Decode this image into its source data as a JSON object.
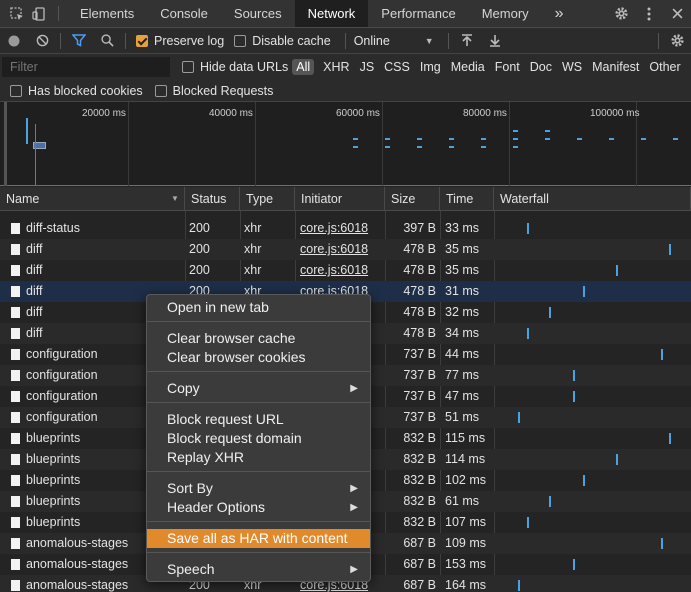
{
  "tabs": [
    "Elements",
    "Console",
    "Sources",
    "Network",
    "Performance",
    "Memory"
  ],
  "active_tab": "Network",
  "more_tabs": "»",
  "toolbar": {
    "preserve_log": "Preserve log",
    "disable_cache": "Disable cache",
    "throttle": "Online"
  },
  "filter": {
    "placeholder": "Filter",
    "hide_data_urls": "Hide data URLs",
    "types": [
      "All",
      "XHR",
      "JS",
      "CSS",
      "Img",
      "Media",
      "Font",
      "Doc",
      "WS",
      "Manifest",
      "Other"
    ],
    "has_blocked_cookies": "Has blocked cookies",
    "blocked_requests": "Blocked Requests"
  },
  "overview_labels": [
    "20000 ms",
    "40000 ms",
    "60000 ms",
    "80000 ms",
    "100000 ms"
  ],
  "columns": [
    "Name",
    "Status",
    "Type",
    "Initiator",
    "Size",
    "Time",
    "Waterfall"
  ],
  "rows": [
    {
      "name": "diff-status",
      "status": "200",
      "type": "xhr",
      "initiator": "core.js:6018",
      "size": "397 B",
      "time": "33 ms",
      "wf": 0.17
    },
    {
      "name": "diff",
      "status": "200",
      "type": "xhr",
      "initiator": "core.js:6018",
      "size": "478 B",
      "time": "35 ms",
      "wf": 0.89
    },
    {
      "name": "diff",
      "status": "200",
      "type": "xhr",
      "initiator": "core.js:6018",
      "size": "478 B",
      "time": "35 ms",
      "wf": 0.62
    },
    {
      "name": "diff",
      "status": "200",
      "type": "xhr",
      "initiator": "core.js:6018",
      "size": "478 B",
      "time": "31 ms",
      "wf": 0.45
    },
    {
      "name": "diff",
      "status": "",
      "type": "",
      "initiator": "",
      "size": "478 B",
      "time": "32 ms",
      "wf": 0.28
    },
    {
      "name": "diff",
      "status": "",
      "type": "",
      "initiator": "",
      "size": "478 B",
      "time": "34 ms",
      "wf": 0.17
    },
    {
      "name": "configuration",
      "status": "",
      "type": "",
      "initiator": "",
      "size": "737 B",
      "time": "44 ms",
      "wf": 0.85
    },
    {
      "name": "configuration",
      "status": "",
      "type": "",
      "initiator": "",
      "size": "737 B",
      "time": "77 ms",
      "wf": 0.4
    },
    {
      "name": "configuration",
      "status": "",
      "type": "",
      "initiator": "",
      "size": "737 B",
      "time": "47 ms",
      "wf": 0.4
    },
    {
      "name": "configuration",
      "status": "",
      "type": "",
      "initiator": "",
      "size": "737 B",
      "time": "51 ms",
      "wf": 0.12
    },
    {
      "name": "blueprints",
      "status": "",
      "type": "",
      "initiator": "",
      "size": "832 B",
      "time": "115 ms",
      "wf": 0.89
    },
    {
      "name": "blueprints",
      "status": "",
      "type": "",
      "initiator": "",
      "size": "832 B",
      "time": "114 ms",
      "wf": 0.62
    },
    {
      "name": "blueprints",
      "status": "",
      "type": "",
      "initiator": "",
      "size": "832 B",
      "time": "102 ms",
      "wf": 0.45
    },
    {
      "name": "blueprints",
      "status": "",
      "type": "",
      "initiator": "",
      "size": "832 B",
      "time": "61 ms",
      "wf": 0.28
    },
    {
      "name": "blueprints",
      "status": "",
      "type": "",
      "initiator": "",
      "size": "832 B",
      "time": "107 ms",
      "wf": 0.17
    },
    {
      "name": "anomalous-stages",
      "status": "",
      "type": "",
      "initiator": "",
      "size": "687 B",
      "time": "109 ms",
      "wf": 0.85
    },
    {
      "name": "anomalous-stages",
      "status": "",
      "type": "",
      "initiator": "",
      "size": "687 B",
      "time": "153 ms",
      "wf": 0.4
    },
    {
      "name": "anomalous-stages",
      "status": "200",
      "type": "xhr",
      "initiator": "core.js:6018",
      "size": "687 B",
      "time": "164 ms",
      "wf": 0.12
    }
  ],
  "context_menu": {
    "open_new_tab": "Open in new tab",
    "clear_cache": "Clear browser cache",
    "clear_cookies": "Clear browser cookies",
    "copy": "Copy",
    "block_url": "Block request URL",
    "block_domain": "Block request domain",
    "replay_xhr": "Replay XHR",
    "sort_by": "Sort By",
    "header_options": "Header Options",
    "save_har": "Save all as HAR with content",
    "speech": "Speech"
  },
  "colors": {
    "accent": "#e08a2c",
    "waterfall": "#4aa3e0",
    "selected_row": "#1e2e48"
  }
}
